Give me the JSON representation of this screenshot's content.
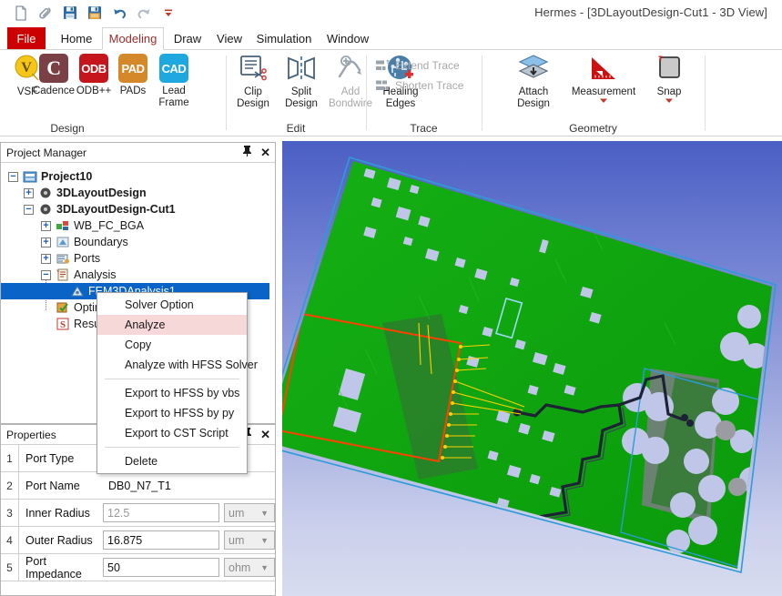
{
  "window": {
    "title": "Hermes - [3DLayoutDesign-Cut1 - 3D View]"
  },
  "quick_access": [
    {
      "name": "new-icon",
      "label": "New"
    },
    {
      "name": "open-icon",
      "label": "Open"
    },
    {
      "name": "save-icon",
      "label": "Save"
    },
    {
      "name": "save-as-icon",
      "label": "Save As"
    },
    {
      "name": "undo-icon",
      "label": "Undo"
    },
    {
      "name": "redo-icon",
      "label": "Redo"
    },
    {
      "name": "customize-qat-icon",
      "label": "Customize Quick Access Toolbar"
    }
  ],
  "tabs": [
    {
      "label": "File",
      "active": false
    },
    {
      "label": "Home",
      "active": false
    },
    {
      "label": "Modeling",
      "active": true
    },
    {
      "label": "Draw",
      "active": false
    },
    {
      "label": "View",
      "active": false
    },
    {
      "label": "Simulation",
      "active": false
    },
    {
      "label": "Window",
      "active": false
    }
  ],
  "ribbon": {
    "groups": [
      {
        "label": "Design"
      },
      {
        "label": "Edit"
      },
      {
        "label": "Trace"
      },
      {
        "label": "Geometry"
      }
    ],
    "design": [
      {
        "label": "VSF",
        "icon": "vsf-icon",
        "badge": "V",
        "color": "#f2c200",
        "disabled": false
      },
      {
        "label": "Cadence",
        "icon": "cadence-icon",
        "badge": "C",
        "color": "#7b3f46",
        "disabled": false
      },
      {
        "label": "ODB++",
        "icon": "odb-icon",
        "badge": "ODB",
        "color": "#c4161c",
        "disabled": false
      },
      {
        "label": "PADs",
        "icon": "pads-icon",
        "badge": "PAD",
        "color": "#d4882a",
        "disabled": false
      },
      {
        "label": "Lead Frame",
        "icon": "lead-frame-icon",
        "badge": "CAD",
        "color": "#1fa8e0",
        "disabled": false
      }
    ],
    "edit": [
      {
        "label": "Clip Design",
        "icon": "clip-design-icon",
        "disabled": false
      },
      {
        "label": "Split Design",
        "icon": "split-design-icon",
        "disabled": false
      },
      {
        "label": "Add Bondwire",
        "icon": "add-bondwire-icon",
        "disabled": true
      },
      {
        "label": "Healing Edges",
        "icon": "healing-edges-icon",
        "disabled": false
      }
    ],
    "trace": [
      {
        "label": "Extend Trace",
        "icon": "extend-trace-icon",
        "disabled": true
      },
      {
        "label": "Shorten Trace",
        "icon": "shorten-trace-icon",
        "disabled": true
      }
    ],
    "geometry": [
      {
        "label": "Attach Design",
        "icon": "attach-design-icon",
        "disabled": false,
        "dropdown": false
      },
      {
        "label": "Measurement",
        "icon": "measurement-icon",
        "disabled": false,
        "dropdown": true
      },
      {
        "label": "Snap",
        "icon": "snap-icon",
        "disabled": false,
        "dropdown": true
      }
    ]
  },
  "project_manager": {
    "title": "Project Manager",
    "pin_icon": "pin-icon",
    "close_icon": "close-icon",
    "tree": [
      {
        "label": "Project10",
        "icon": "project-icon",
        "expander": "-",
        "bold": true,
        "depth": 0
      },
      {
        "label": "3DLayoutDesign",
        "icon": "design-icon",
        "expander": "+",
        "bold": true,
        "depth": 1
      },
      {
        "label": "3DLayoutDesign-Cut1",
        "icon": "design-icon",
        "expander": "-",
        "bold": true,
        "depth": 1
      },
      {
        "label": "WB_FC_BGA",
        "icon": "model-icon",
        "expander": "+",
        "bold": false,
        "depth": 2
      },
      {
        "label": "Boundarys",
        "icon": "boundaries-icon",
        "expander": "+",
        "bold": false,
        "depth": 2
      },
      {
        "label": "Ports",
        "icon": "ports-icon",
        "expander": "+",
        "bold": false,
        "depth": 2
      },
      {
        "label": "Analysis",
        "icon": "analysis-icon",
        "expander": "-",
        "bold": false,
        "depth": 2
      },
      {
        "label": "FEM3DAnalysis1",
        "icon": "setup-icon",
        "expander": "",
        "bold": false,
        "depth": 3,
        "selected": true
      },
      {
        "label": "Optimetrics",
        "icon": "optimetrics-icon",
        "expander": "",
        "bold": false,
        "depth": 2
      },
      {
        "label": "Results",
        "icon": "results-icon",
        "expander": "",
        "bold": false,
        "depth": 2
      }
    ]
  },
  "context_menu": [
    {
      "label": "Solver Option",
      "highlight": false,
      "separator_after": false
    },
    {
      "label": "Analyze",
      "highlight": true,
      "separator_after": false
    },
    {
      "label": "Copy",
      "highlight": false,
      "separator_after": false
    },
    {
      "label": "Analyze with HFSS Solver",
      "highlight": false,
      "separator_after": true
    },
    {
      "label": "Export to HFSS by vbs",
      "highlight": false,
      "separator_after": false
    },
    {
      "label": "Export to HFSS by py",
      "highlight": false,
      "separator_after": false
    },
    {
      "label": "Export to CST Script",
      "highlight": false,
      "separator_after": true
    },
    {
      "label": "Delete",
      "highlight": false,
      "separator_after": false
    }
  ],
  "properties": {
    "title": "Properties",
    "pin_icon": "pin-icon",
    "close_icon": "close-icon",
    "rows": [
      {
        "num": "1",
        "name": "Port Type",
        "value": "",
        "type": "text",
        "unit": ""
      },
      {
        "num": "2",
        "name": "Port Name",
        "value": "DB0_N7_T1",
        "type": "text",
        "unit": ""
      },
      {
        "num": "3",
        "name": "Inner Radius",
        "value": "12.5",
        "type": "input",
        "placeholder": true,
        "unit": "um"
      },
      {
        "num": "4",
        "name": "Outer Radius",
        "value": "16.875",
        "type": "input",
        "placeholder": false,
        "unit": "um"
      },
      {
        "num": "5",
        "name": "Port Impedance",
        "value": "50",
        "type": "input",
        "placeholder": false,
        "unit": "ohm"
      }
    ]
  },
  "view3d": {
    "name": "3d-viewport",
    "background_top": "#4a5fc4",
    "background_bottom": "#d8dcf0",
    "board_color": "#0aa00a",
    "board_shadow_color": "#2f7a2f",
    "pad_color": "#c0c6e8",
    "trace_color": "#1e2235",
    "selection_box_color": "#ff4000",
    "outline_color": "#2e9bd8",
    "port_arrow_color": "#ffd000"
  }
}
